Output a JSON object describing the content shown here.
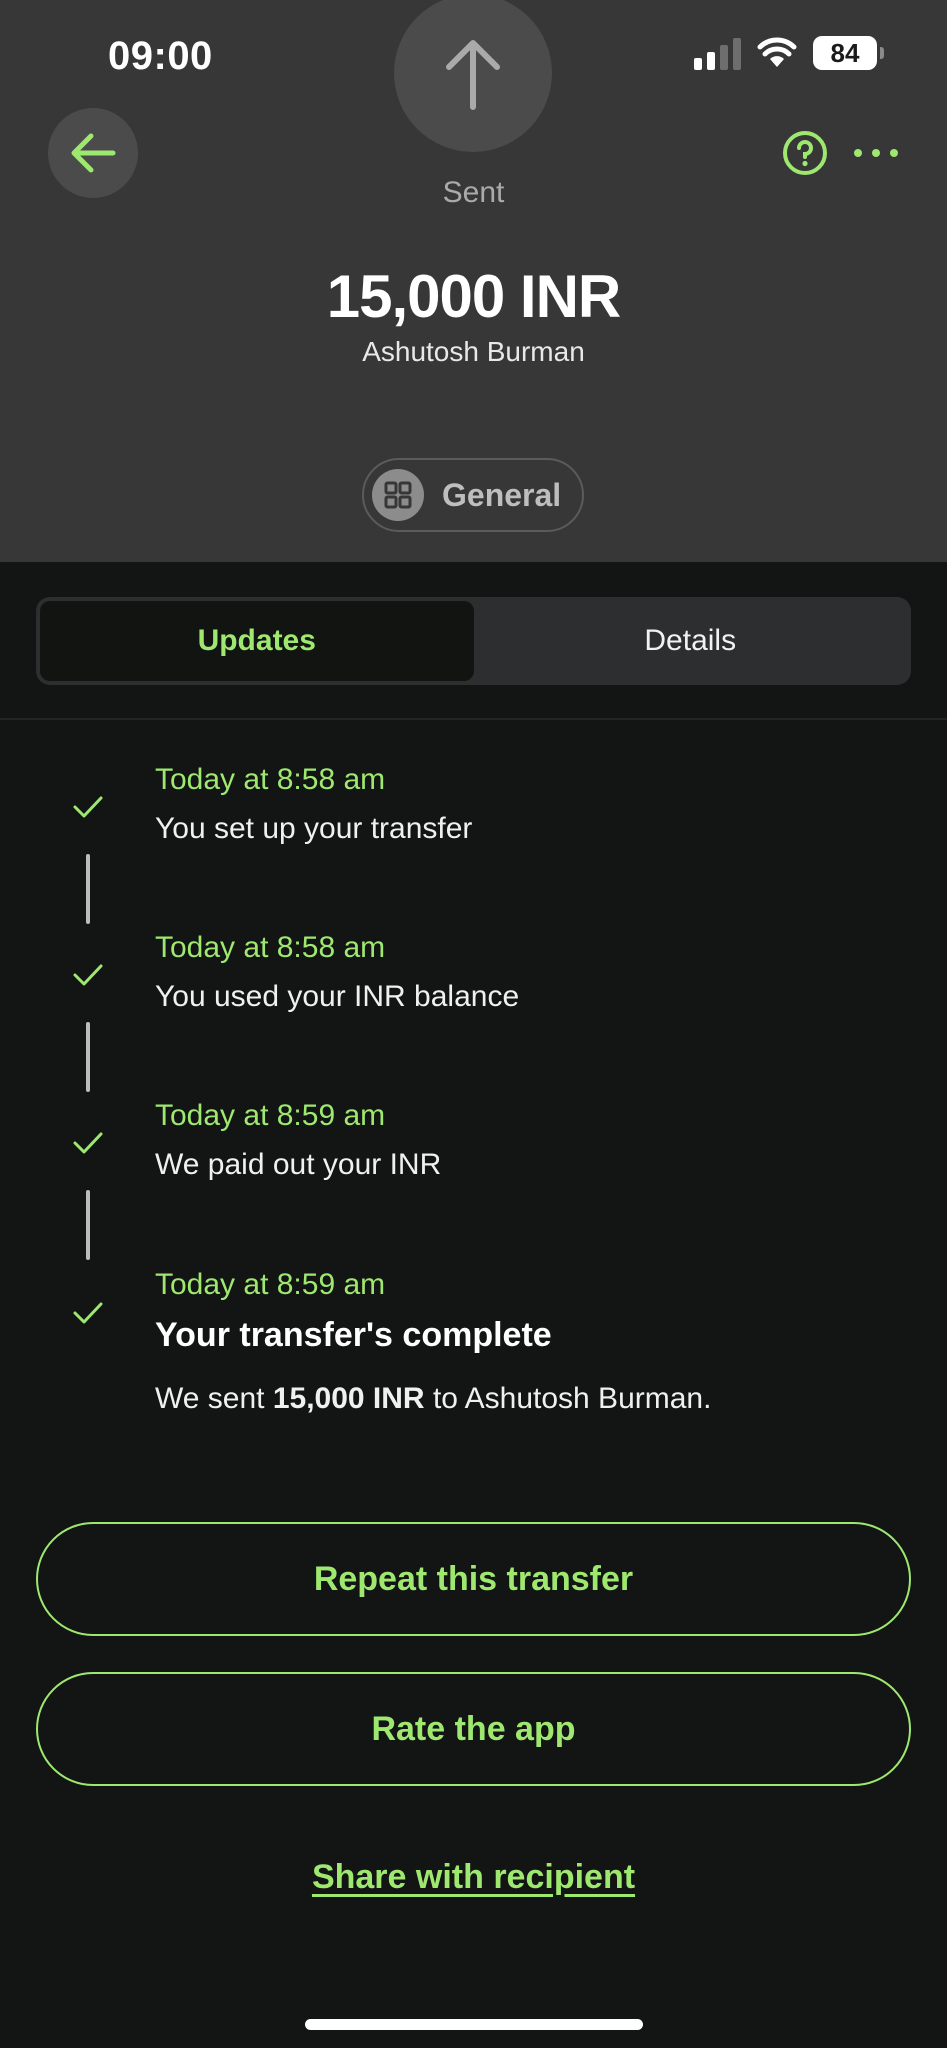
{
  "status_bar": {
    "time": "09:00",
    "battery": "84"
  },
  "header": {
    "status_label": "Sent",
    "amount": "15,000 INR",
    "recipient": "Ashutosh Burman",
    "category": "General"
  },
  "tabs": [
    {
      "label": "Updates",
      "active": true
    },
    {
      "label": "Details",
      "active": false
    }
  ],
  "updates": [
    {
      "time": "Today at 8:58 am",
      "text": "You set up your transfer"
    },
    {
      "time": "Today at 8:58 am",
      "text": "You used your INR balance"
    },
    {
      "time": "Today at 8:59 am",
      "text": "We paid out your INR"
    },
    {
      "time": "Today at 8:59 am",
      "title": "Your transfer's complete",
      "detail_prefix": "We sent ",
      "detail_amount": "15,000 INR",
      "detail_suffix": " to Ashutosh Burman."
    }
  ],
  "actions": {
    "repeat": "Repeat this transfer",
    "rate": "Rate the app",
    "share": "Share with recipient"
  },
  "colors": {
    "accent": "#9fe870",
    "header_bg": "#363736",
    "page_bg": "#131514"
  }
}
